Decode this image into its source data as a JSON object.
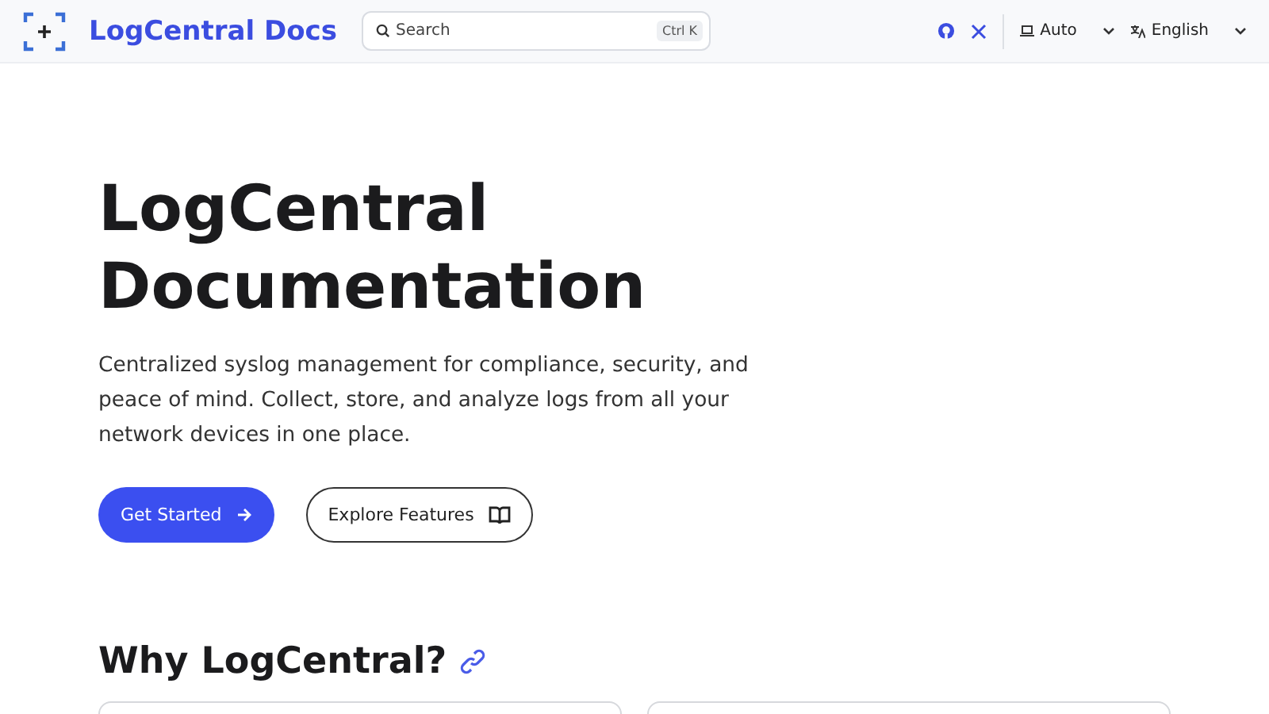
{
  "header": {
    "title": "LogCentral Docs",
    "search": {
      "placeholder": "Search",
      "shortcut": "Ctrl K"
    },
    "theme": "Auto",
    "language": "English"
  },
  "hero": {
    "title": "LogCentral Documentation",
    "description": "Centralized syslog management for compliance, security, and peace of mind. Collect, store, and analyze logs from all your network devices in one place.",
    "buttons": [
      {
        "label": "Get Started",
        "kind": "primary"
      },
      {
        "label": "Explore Features",
        "kind": "secondary"
      }
    ]
  },
  "section": {
    "title": "Why LogCentral?",
    "cards": [
      {
        "kind": "feature"
      },
      {
        "kind": "feature"
      }
    ]
  }
}
